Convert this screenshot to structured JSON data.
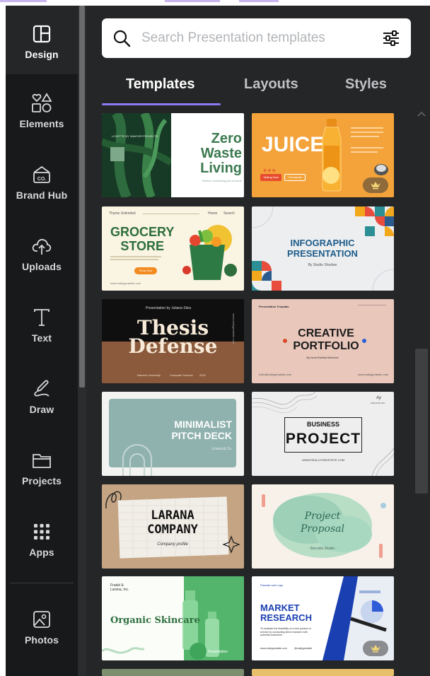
{
  "sidebar": {
    "items": [
      {
        "label": "Design",
        "icon": "layout-icon"
      },
      {
        "label": "Elements",
        "icon": "shapes-icon"
      },
      {
        "label": "Brand Hub",
        "icon": "brand-icon"
      },
      {
        "label": "Uploads",
        "icon": "cloud-upload-icon"
      },
      {
        "label": "Text",
        "icon": "text-icon"
      },
      {
        "label": "Draw",
        "icon": "draw-icon"
      },
      {
        "label": "Projects",
        "icon": "folder-icon"
      },
      {
        "label": "Apps",
        "icon": "apps-grid-icon"
      },
      {
        "label": "Photos",
        "icon": "photo-icon"
      }
    ],
    "brand_badge": "CO."
  },
  "search": {
    "placeholder": "Search Presentation templates"
  },
  "tabs": [
    {
      "label": "Templates",
      "active": true
    },
    {
      "label": "Layouts",
      "active": false
    },
    {
      "label": "Styles",
      "active": false
    }
  ],
  "templates": [
    {
      "lines": [
        "Zero",
        "Waste",
        "Living"
      ],
      "sub": "Reduce everything just at home",
      "topline": "LOVETTE BY SAWYER PROJECTS"
    },
    {
      "lines": [
        "JUICE"
      ],
      "buttons": [
        "Tasting Now",
        "Thumbnail"
      ],
      "premium": true
    },
    {
      "lines": [
        "GROCERY",
        "STORE"
      ],
      "header": "Thyme Unlimited",
      "nav": [
        "Home",
        "Search"
      ],
      "button": "Shop Now",
      "url": "www.reallygreatsite.com"
    },
    {
      "lines": [
        "INFOGRAPHIC",
        "PRESENTATION"
      ],
      "sub": "By Studio Shodwe"
    },
    {
      "lines": [
        "Thesis",
        "Defense"
      ],
      "top": "Presentation by Juliana Silva",
      "side": "www.reallygreatsite.com",
      "footer": [
        "Nameer University",
        "Computer Science",
        "2022"
      ]
    },
    {
      "lines": [
        "CREATIVE",
        "PORTFOLIO"
      ],
      "top": "Presentation Template",
      "sub": "By Isma Estrilsa Marchoé",
      "footer": [
        "hello@reallygreatsite.com",
        "www.reallygreatsite.com"
      ]
    },
    {
      "lines": [
        "MINIMALIST",
        "PITCH DECK"
      ],
      "sub": "Liceria & Co."
    },
    {
      "lines": [
        "BUSINESS",
        "PROJECT"
      ],
      "sub": "WWW.REALLYGREATSITE.COM",
      "corner": "Ay",
      "corner_sub": "ARGHATE INC."
    },
    {
      "lines": [
        "LARANA",
        "COMPANY"
      ],
      "sub": "Company profile"
    },
    {
      "lines": [
        "Project",
        "Proposal"
      ],
      "sub": "- Borcelle Studio -"
    },
    {
      "lines": [
        "Organic Skincare"
      ],
      "top": [
        "Fradel &",
        "Larana, Inc."
      ],
      "label": "Presentation"
    },
    {
      "lines": [
        "MARKET",
        "RESEARCH"
      ],
      "top": "Pascale and Logo",
      "body": "To evaluate the feasibility of a new product or service by conducting direct research with potential customers",
      "footer": [
        "www.reallygreatsite.com",
        "@reallygreatsite"
      ],
      "premium": true
    }
  ],
  "colors": {
    "rail": "#18191b",
    "panel": "#252627",
    "accent": "#8b7bf3",
    "search_bg": "#ffffff"
  }
}
